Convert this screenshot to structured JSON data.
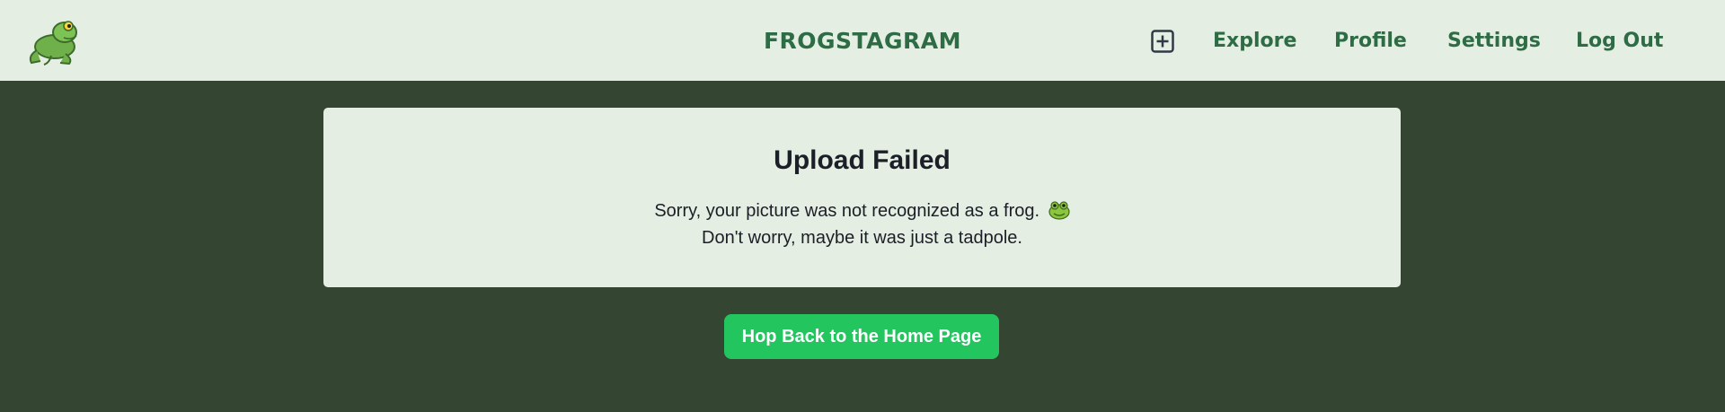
{
  "header": {
    "logo_icon": "frog-logo-icon",
    "brand": "FROGSTAGRAM",
    "new_post_icon": "plus-square-icon",
    "nav": {
      "explore": "Explore",
      "profile": "Profile",
      "settings": "Settings",
      "logout": "Log Out"
    }
  },
  "main": {
    "title": "Upload Failed",
    "message_line1": "Sorry, your picture was not recognized as a frog.",
    "message_emoji_icon": "frog-face-icon",
    "message_line2": "Don't worry, maybe it was just a tadpole.",
    "home_button": "Hop Back to the Home Page"
  },
  "colors": {
    "page_background": "#344531",
    "navbar_background": "#e4eee2",
    "card_background": "#e4eee2",
    "brand_green": "#2e6c45",
    "button_green": "#22c55e"
  }
}
